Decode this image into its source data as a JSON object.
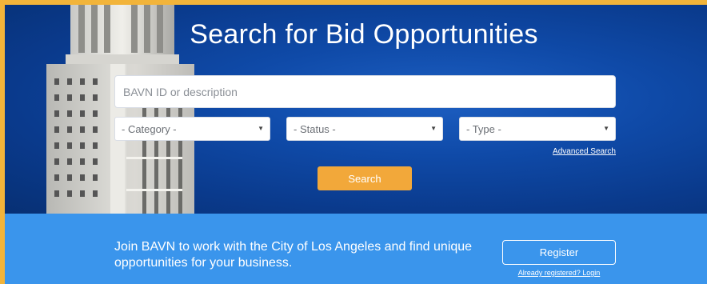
{
  "hero": {
    "title": "Search for Bid Opportunities",
    "search_placeholder": "BAVN ID or description",
    "category_select": "- Category -",
    "status_select": "- Status -",
    "type_select": "- Type -",
    "advanced_link": "Advanced Search",
    "search_button": "Search",
    "caret": "▼"
  },
  "band": {
    "text": "Join BAVN to work with the City of Los Angeles and find unique opportunities for your business.",
    "register_button": "Register",
    "login_link": "Already registered? Login"
  },
  "colors": {
    "frame": "#f2b43a",
    "hero_blue": "#0f4aa8",
    "band_blue": "#3a95ec",
    "accent_orange": "#f2a83a"
  },
  "icons": {
    "select_caret": "caret-down-icon",
    "hero_image": "city-hall-tower-image"
  }
}
